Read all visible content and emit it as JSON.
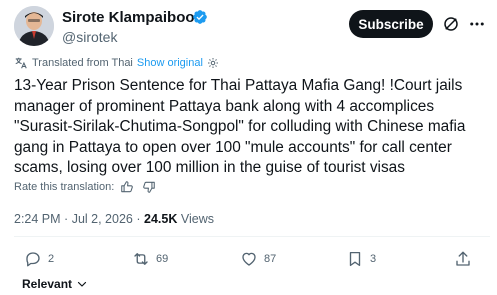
{
  "author": {
    "name": "Sirote Klampaiboon",
    "handle": "@sirotek",
    "verified_color": "#1d9bf0"
  },
  "header": {
    "subscribe_label": "Subscribe"
  },
  "translation": {
    "prefix": "Translated from Thai",
    "show_original": "Show original"
  },
  "post": {
    "text": "13-Year Prison Sentence for Thai Pattaya Mafia Gang! !Court jails manager of prominent Pattaya bank along with 4 accomplices \"Surasit-Sirilak-Chutima-Songpol\" for colluding with Chinese mafia gang in Pattaya to open over 100 \"mule accounts\" for call center scams, losing over 100 million in the guise of tourist visas"
  },
  "rate": {
    "label": "Rate this translation:"
  },
  "meta": {
    "time": "2:24 PM",
    "separator": "·",
    "date": "Jul 2, 2026",
    "views_count": "24.5K",
    "views_label": "Views"
  },
  "actions": {
    "replies": "2",
    "reposts": "69",
    "likes": "87",
    "bookmarks": "3"
  },
  "footer": {
    "relevant_label": "Relevant"
  },
  "icons": {
    "verified": "verified-badge-icon",
    "grok": "grok-icon",
    "more": "more-icon",
    "translate": "translate-gear-icon",
    "thumbs_up": "thumbs-up-icon",
    "thumbs_down": "thumbs-down-icon",
    "reply": "reply-icon",
    "repost": "repost-icon",
    "like": "heart-icon",
    "bookmark": "bookmark-icon",
    "share": "share-icon",
    "chevron": "chevron-down-icon"
  }
}
